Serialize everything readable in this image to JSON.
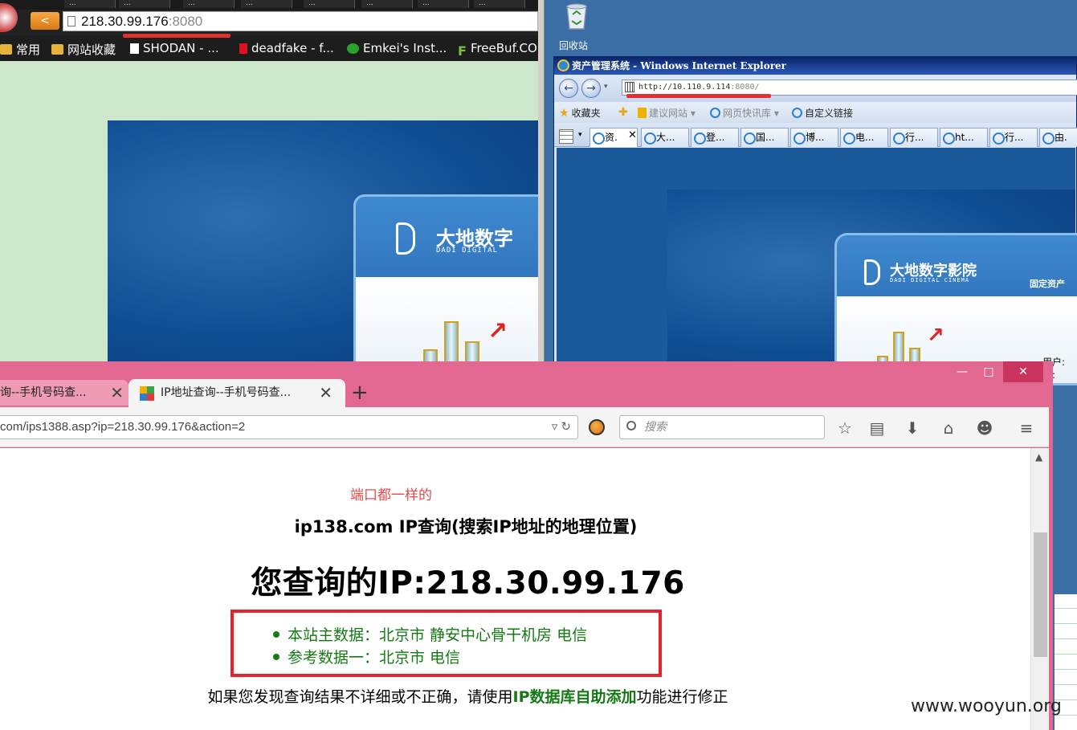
{
  "left_browser": {
    "tabs": [
      "...",
      "...",
      "...",
      "...",
      "...",
      "...",
      "...",
      "..."
    ],
    "back_label": "<",
    "url_host": "218.30.99.176",
    "url_port": ":8080",
    "bookmarks": [
      "常用",
      "网站收藏",
      "SHODAN - ...",
      "deadfake - f...",
      "Emkei's Inst...",
      "FreeBuf.CO"
    ],
    "logo_cn": "大地数字",
    "logo_en": "DADI DIGITAL"
  },
  "desktop": {
    "recycle_bin_label": "回收站"
  },
  "ie_window": {
    "title": "资产管理系统 - Windows Internet Explorer",
    "url_host": "http://10.110.9.114",
    "url_port": ":8080/",
    "favorites": [
      "收藏夹",
      "建议网站 ▾",
      "网页快讯库 ▾",
      "自定义链接"
    ],
    "tabs": [
      "资.",
      "大...",
      "登...",
      "国...",
      "博...",
      "电...",
      "行...",
      "ht...",
      "行...",
      "由."
    ],
    "logo_cn": "大地数字影院",
    "logo_en": "DADI DIGITAL CINEMA",
    "panel_caption": "固定资产",
    "side_labels": [
      "用户:",
      "码:"
    ]
  },
  "firefox": {
    "tab1_title": "询--手机号码查...",
    "tab2_title": "IP地址查询--手机号码查...",
    "new_tab": "+",
    "url": "com/ips1388.asp?ip=218.30.99.176&action=2",
    "search_placeholder": "搜索",
    "win_min": "—",
    "win_max": "□",
    "win_close": "✕"
  },
  "page": {
    "note": "端口都一样的",
    "heading1": "ip138.com IP查询(搜索IP地址的地理位置)",
    "heading2": "您查询的IP:218.30.99.176",
    "result1": "本站主数据：北京市 静安中心骨干机房 电信",
    "result2": "参考数据一：北京市 电信",
    "footer_prefix": "如果您发现查询结果不详细或不正确，请使用",
    "footer_link": "IP数据库自助添加",
    "footer_suffix": "功能进行修正"
  },
  "watermark": "www.wooyun.org",
  "colors": {
    "firefox_theme": "#e26891",
    "result_green": "#157a15",
    "highlight_red": "#e4232b",
    "note_red": "#e84a4a"
  }
}
